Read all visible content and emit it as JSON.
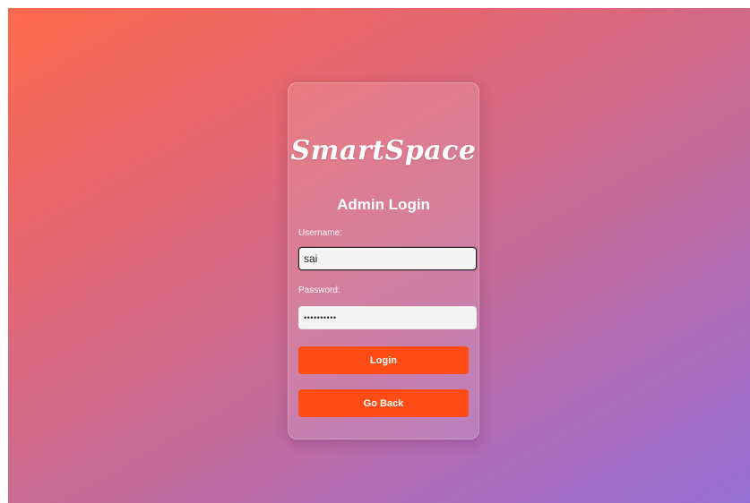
{
  "brand": {
    "logo_text": "SmartSpace"
  },
  "form": {
    "title": "Admin Login",
    "username_label": "Username:",
    "username_value": "sai",
    "password_label": "Password:",
    "password_value": "••••••••••",
    "login_label": "Login",
    "back_label": "Go Back"
  },
  "colors": {
    "gradient_start": "#fd6a4d",
    "gradient_end": "#966fd6",
    "button": "#ff4b14"
  }
}
